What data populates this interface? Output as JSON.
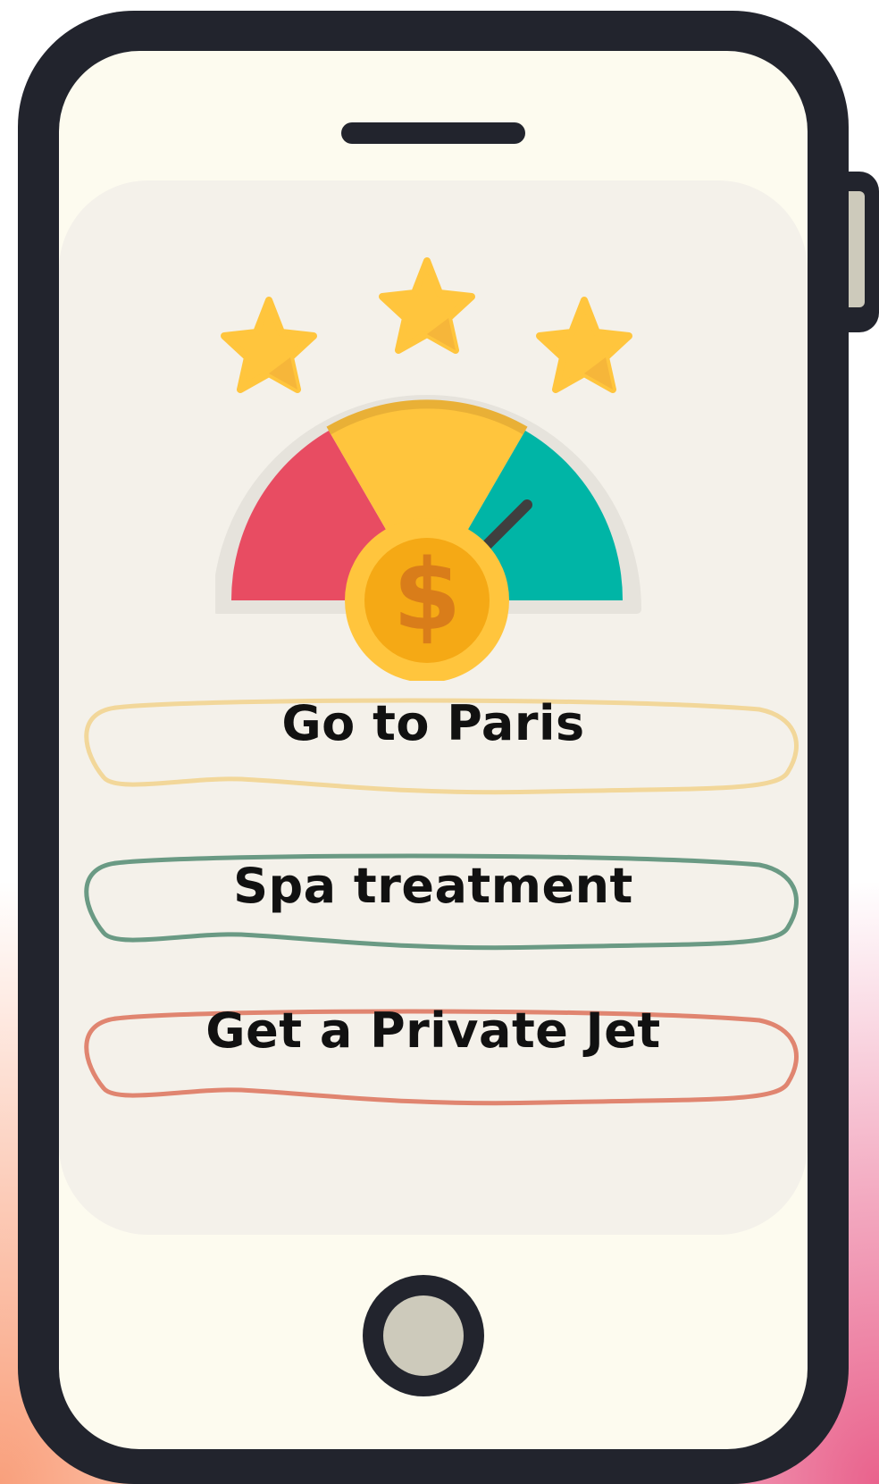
{
  "options": [
    {
      "label": "Go to Paris",
      "color": "#f2d79a"
    },
    {
      "label": "Spa treatment",
      "color": "#6a9a84"
    },
    {
      "label": "Get a Private Jet",
      "color": "#e08570"
    }
  ],
  "rating": {
    "stars": 3
  },
  "gauge": {
    "segments": [
      "#e84c62",
      "#ffc53d",
      "#00b5a6"
    ],
    "icon": "dollar-coin-icon"
  },
  "colors": {
    "phone_body": "#22242d",
    "screen": "#fdfbef",
    "card": "#f4f1ea",
    "home_button": "#cdcabb"
  }
}
